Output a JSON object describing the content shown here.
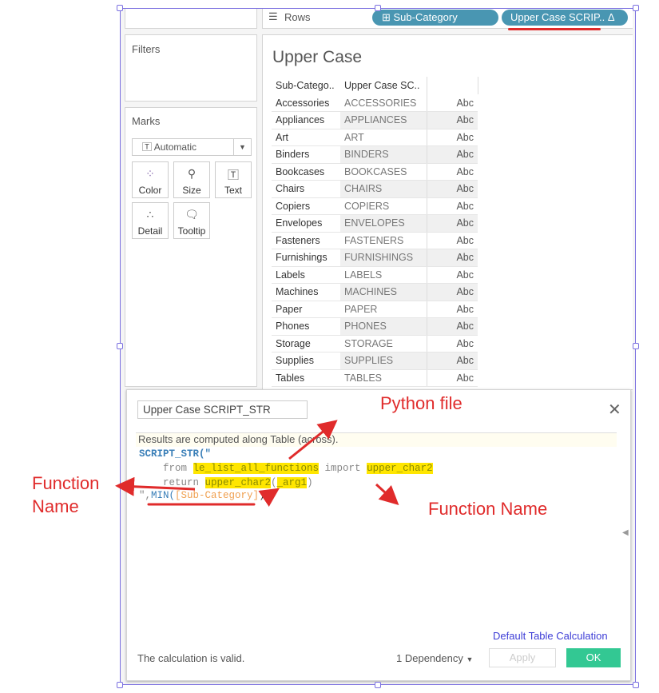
{
  "shelf": {
    "rows_label": "Rows",
    "pills": [
      "Sub-Category",
      "Upper Case SCRIP.. Δ"
    ]
  },
  "filters": {
    "title": "Filters"
  },
  "marks": {
    "title": "Marks",
    "type": "Automatic",
    "buttons": [
      "Color",
      "Size",
      "Text",
      "Detail",
      "Tooltip"
    ]
  },
  "view": {
    "title": "Upper Case",
    "headers": [
      "Sub-Catego..",
      "Upper Case SC..",
      ""
    ],
    "rows": [
      [
        "Accessories",
        "ACCESSORIES",
        "Abc"
      ],
      [
        "Appliances",
        "APPLIANCES",
        "Abc"
      ],
      [
        "Art",
        "ART",
        "Abc"
      ],
      [
        "Binders",
        "BINDERS",
        "Abc"
      ],
      [
        "Bookcases",
        "BOOKCASES",
        "Abc"
      ],
      [
        "Chairs",
        "CHAIRS",
        "Abc"
      ],
      [
        "Copiers",
        "COPIERS",
        "Abc"
      ],
      [
        "Envelopes",
        "ENVELOPES",
        "Abc"
      ],
      [
        "Fasteners",
        "FASTENERS",
        "Abc"
      ],
      [
        "Furnishings",
        "FURNISHINGS",
        "Abc"
      ],
      [
        "Labels",
        "LABELS",
        "Abc"
      ],
      [
        "Machines",
        "MACHINES",
        "Abc"
      ],
      [
        "Paper",
        "PAPER",
        "Abc"
      ],
      [
        "Phones",
        "PHONES",
        "Abc"
      ],
      [
        "Storage",
        "STORAGE",
        "Abc"
      ],
      [
        "Supplies",
        "SUPPLIES",
        "Abc"
      ],
      [
        "Tables",
        "TABLES",
        "Abc"
      ]
    ]
  },
  "dialog": {
    "name": "Upper Case SCRIPT_STR",
    "info": "Results are computed along Table (across).",
    "code": {
      "l1": "SCRIPT_STR(\"",
      "from": "    from ",
      "module": "le_list_all_functions",
      "import": " import ",
      "fn": "upper_char2",
      "ret": "    return ",
      "fn2": "upper_char2",
      "paren": "(",
      "arg": "_arg1",
      "close": ")",
      "l4a": "\",",
      "min": "MIN(",
      "field": "[Sub-Category]",
      "l4b": "))"
    },
    "default_calc": "Default Table Calculation",
    "status": "The calculation is valid.",
    "dependency": "1 Dependency",
    "apply": "Apply",
    "ok": "OK"
  },
  "annotations": {
    "python_file": "Python file",
    "function_name_left": "Function Name",
    "function_name_right": "Function Name"
  },
  "colors": {
    "pill": "#4996b2",
    "ok": "#33c893",
    "highlight": "#ffe600",
    "annotation": "#e02b2b",
    "link": "#3d3dd6"
  }
}
